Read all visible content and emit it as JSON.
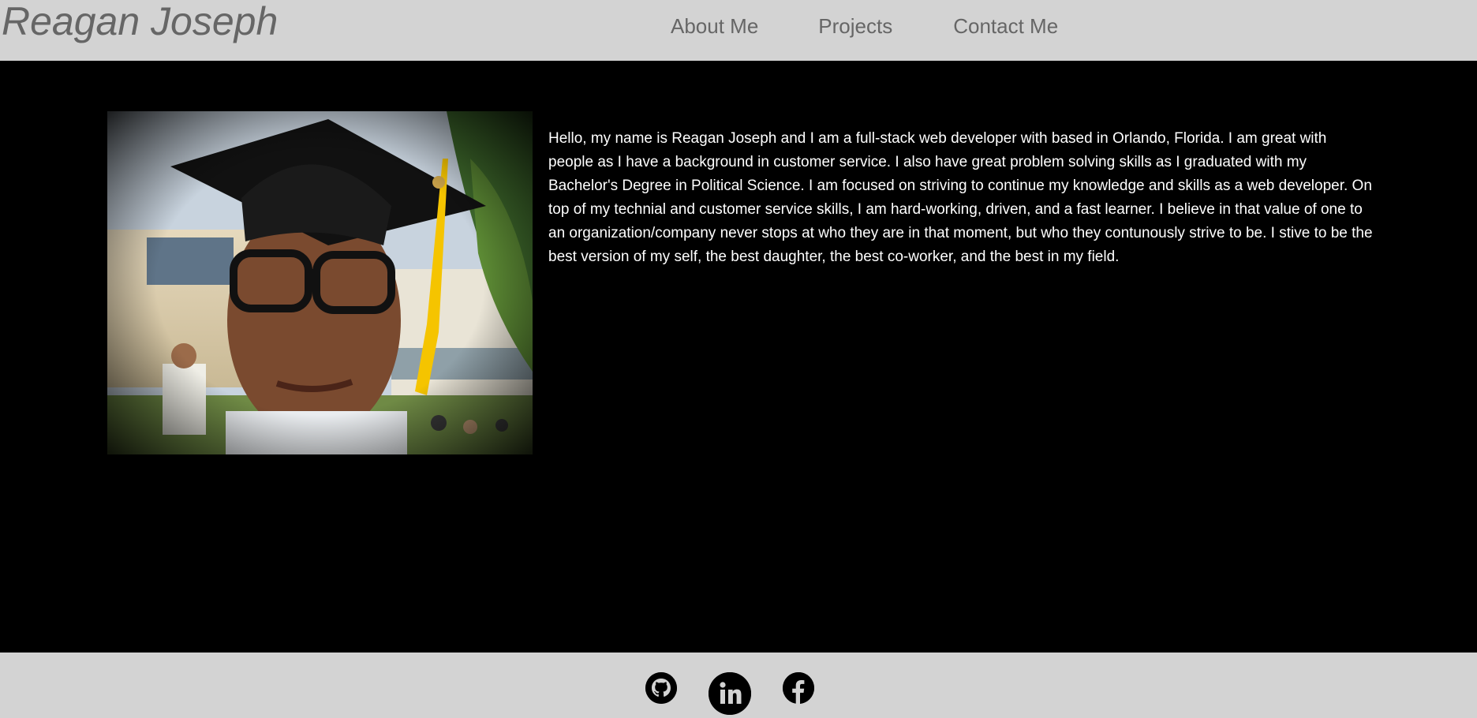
{
  "header": {
    "title": "Reagan Joseph",
    "nav": [
      {
        "label": "About Me"
      },
      {
        "label": "Projects"
      },
      {
        "label": "Contact Me"
      }
    ]
  },
  "about": {
    "bio": "Hello, my name is Reagan Joseph and I am a full-stack web developer with based in Orlando, Florida. I am great with people as I have a background in customer service. I also have great problem solving skills as I graduated with my Bachelor's Degree in Political Science. I am focused on striving to continue my knowledge and skills as a web developer. On top of my technial and customer service skills, I am hard-working, driven, and a fast learner. I believe in that value of one to an organization/company never stops at who they are in that moment, but who they contunously strive to be. I stive to be the best version of my self, the best daughter, the best co-worker, and the best in my field.",
    "photo_icon": "graduation-portrait-photo"
  },
  "footer": {
    "social": [
      {
        "icon": "github-icon"
      },
      {
        "icon": "linkedin-icon"
      },
      {
        "icon": "facebook-icon"
      }
    ]
  },
  "colors": {
    "header_bg": "#d3d3d3",
    "main_bg": "#000000",
    "header_text": "#666666",
    "body_text": "#ffffff",
    "tassel": "#f5c400"
  }
}
